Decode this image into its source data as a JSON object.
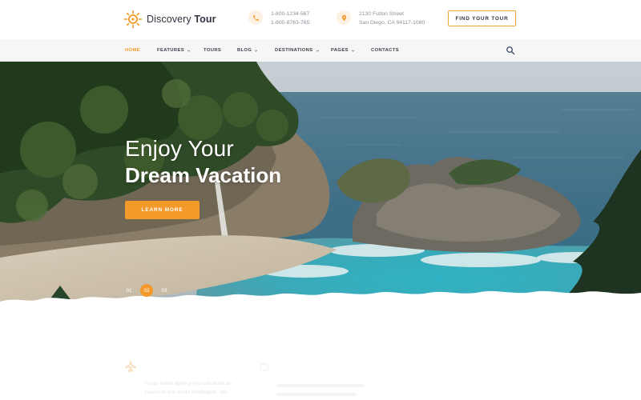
{
  "brand": {
    "name_light": "Discovery",
    "name_bold": "Tour",
    "accent": "#f39a2b"
  },
  "header": {
    "phones": [
      "1-800-1234-567",
      "1-800-8763-765"
    ],
    "address": [
      "2130 Fulton Street",
      "San Diego, CA 94117-1080"
    ],
    "cta_label": "FIND YOUR TOUR",
    "phone_icon": "phone-icon",
    "address_icon": "map-pin-icon"
  },
  "nav": {
    "items": [
      {
        "label": "HOME",
        "active": true,
        "dropdown": false
      },
      {
        "label": "FEATURES",
        "active": false,
        "dropdown": true
      },
      {
        "label": "TOURS",
        "active": false,
        "dropdown": false
      },
      {
        "label": "BLOG",
        "active": false,
        "dropdown": true
      },
      {
        "label": "DESTINATIONS",
        "active": false,
        "dropdown": true
      },
      {
        "label": "PAGES",
        "active": false,
        "dropdown": true
      },
      {
        "label": "CONTACTS",
        "active": false,
        "dropdown": false
      }
    ],
    "search_icon": "search-icon"
  },
  "hero": {
    "title_light": "Enjoy Your",
    "title_bold": "Dream Vacation",
    "button_label": "LEARN MORE",
    "slides": [
      "01",
      "02",
      "03"
    ],
    "active_slide": "02"
  },
  "features": {
    "left_text": [
      "At our travel agency you can book an",
      "travels to any world destination. We"
    ],
    "left_icon": "airplane-icon",
    "right_icon": "suitcase-icon"
  }
}
